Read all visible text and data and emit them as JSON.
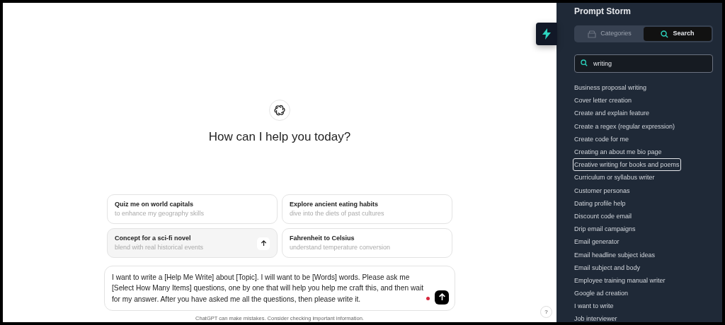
{
  "chat": {
    "heading": "How can I help you today?",
    "suggestions": [
      {
        "title": "Quiz me on world capitals",
        "subtitle": "to enhance my geography skills",
        "hovered": false
      },
      {
        "title": "Explore ancient eating habits",
        "subtitle": "dive into the diets of past cultures",
        "hovered": false
      },
      {
        "title": "Concept for a sci-fi novel",
        "subtitle": "blend with real historical events",
        "hovered": true
      },
      {
        "title": "Fahrenheit to Celsius",
        "subtitle": "understand temperature conversion",
        "hovered": false
      }
    ],
    "message": "I want to write a [Help Me Write] about [Topic]. I will want to be [Words] words. Please ask me [Select How Many Items] questions, one by one that will help you help me craft this, and then wait for my answer. After you have asked me all the questions, then please write it.",
    "disclaimer": "ChatGPT can make mistakes. Consider checking important information.",
    "help": "?"
  },
  "sidebar": {
    "title": "Prompt Storm",
    "tabs": [
      {
        "label": "Categories",
        "kind": "categories",
        "selected": false
      },
      {
        "label": "Search",
        "kind": "search",
        "selected": true
      }
    ],
    "search": {
      "value": "writing"
    },
    "prompts": [
      {
        "label": "Business proposal writing",
        "selected": false
      },
      {
        "label": "Cover letter creation",
        "selected": false
      },
      {
        "label": "Create and explain feature",
        "selected": false
      },
      {
        "label": "Create a regex (regular expression)",
        "selected": false
      },
      {
        "label": "Create code for me",
        "selected": false
      },
      {
        "label": "Creating an about me bio page",
        "selected": false
      },
      {
        "label": "Creative writing for books and poems",
        "selected": true
      },
      {
        "label": "Curriculum or syllabus writer",
        "selected": false
      },
      {
        "label": "Customer personas",
        "selected": false
      },
      {
        "label": "Dating profile help",
        "selected": false
      },
      {
        "label": "Discount code email",
        "selected": false
      },
      {
        "label": "Drip email campaigns",
        "selected": false
      },
      {
        "label": "Email generator",
        "selected": false
      },
      {
        "label": "Email headline subject ideas",
        "selected": false
      },
      {
        "label": "Email subject and body",
        "selected": false
      },
      {
        "label": "Employee training manual writer",
        "selected": false
      },
      {
        "label": "Google ad creation",
        "selected": false
      },
      {
        "label": "I want to write",
        "selected": false
      },
      {
        "label": "Job interviewer",
        "selected": false
      }
    ]
  }
}
